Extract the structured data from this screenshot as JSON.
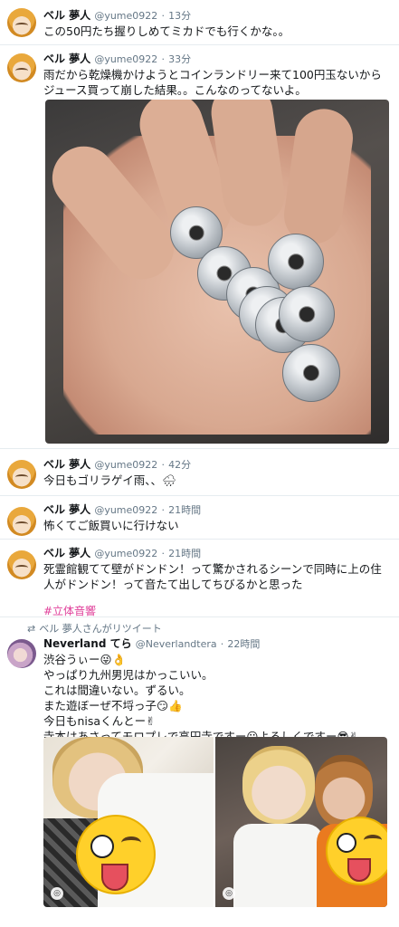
{
  "colors": {
    "link": "#1da1f2",
    "hashtag": "#e0409a",
    "muted": "#657786"
  },
  "tweets": [
    {
      "name": "ベル 夢人",
      "handle": "@yume0922",
      "time": "13分",
      "text": "この50円たち握りしめてミカドでも行くかな。。"
    },
    {
      "name": "ベル 夢人",
      "handle": "@yume0922",
      "time": "33分",
      "text": "雨だから乾燥機かけようとコインランドリー来て100円玉ないからジュース買って崩した結果。。こんなのってないよ。"
    },
    {
      "name": "ベル 夢人",
      "handle": "@yume0922",
      "time": "42分",
      "text": "今日もゴリラゲイ雨、、🌧"
    },
    {
      "name": "ベル 夢人",
      "handle": "@yume0922",
      "time": "21時間",
      "text": "怖くてご飯買いに行けない"
    },
    {
      "name": "ベル 夢人",
      "handle": "@yume0922",
      "time": "21時間",
      "text": "死霊館観てて壁がドンドン！って驚かされるシーンで同時に上の住人がドンドン！って音たて出してちびるかと思った",
      "hashtag": "#立体音響"
    }
  ],
  "retweet": {
    "context": "ベル 夢人さんがリツイート",
    "name": "Neverland てら",
    "handle": "@Neverlandtera",
    "time": "22時間",
    "lines": [
      "渋谷うぃー😜👌",
      "やっぱり九州男児はかっこいい。",
      "これは間違いない。ずるい。",
      "また遊ぼーぜ不埒っ子😏👍",
      "今日もnisaくんとー✌",
      "寺本はあさってモロプレで高円寺ですー☺よろしくですー😎✌"
    ]
  }
}
